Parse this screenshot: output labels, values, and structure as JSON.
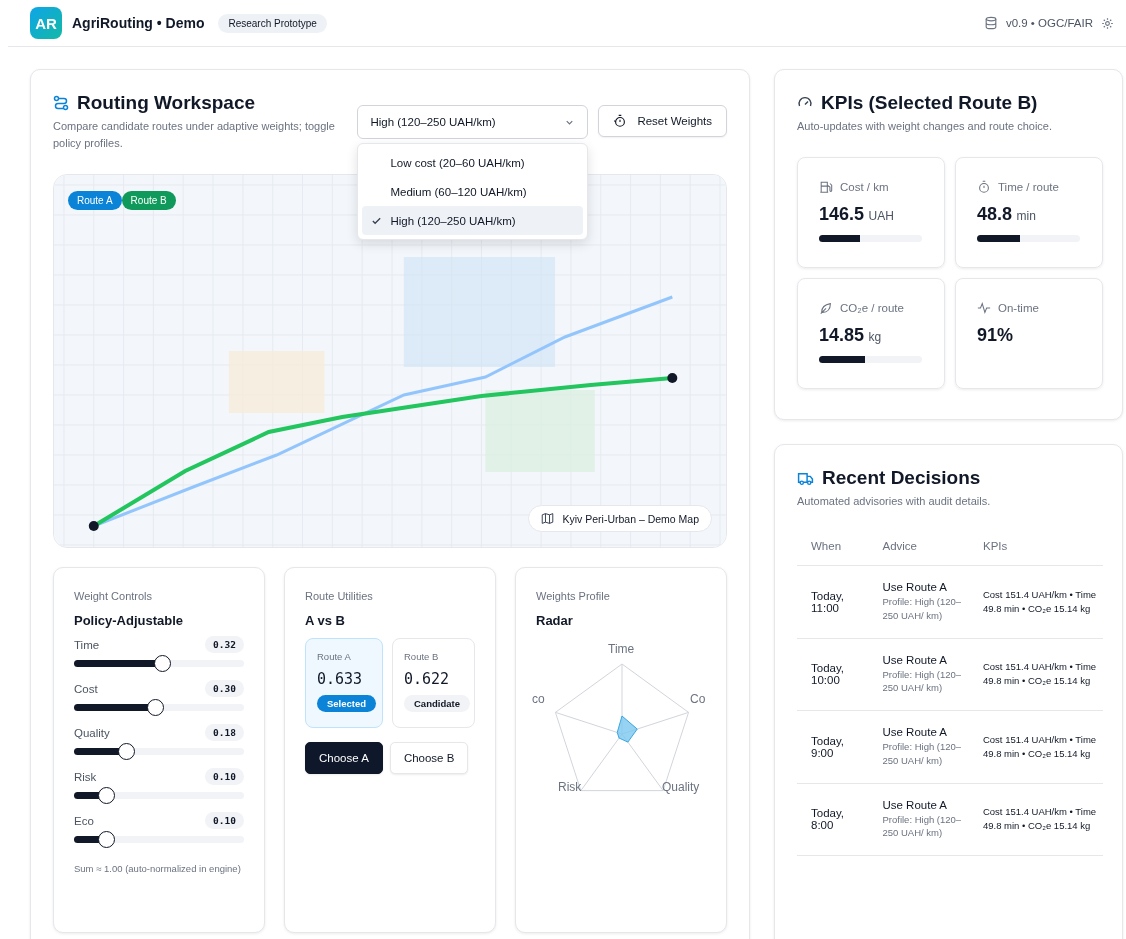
{
  "header": {
    "logo": "AR",
    "title": "AgriRouting • Demo",
    "badge": "Research Prototype",
    "version": "v0.9 • OGC/FAIR"
  },
  "workspace": {
    "title": "Routing Workspace",
    "subtitle": "Compare candidate routes under adaptive weights; toggle policy profiles.",
    "select": {
      "value": "High (120–250 UAH/km)",
      "options": [
        {
          "label": "Low cost (20–60 UAH/km)",
          "selected": false
        },
        {
          "label": "Medium (60–120 UAH/km)",
          "selected": false
        },
        {
          "label": "High (120–250 UAH/km)",
          "selected": true
        }
      ]
    },
    "reset_button": "Reset Weights",
    "map": {
      "legend": [
        {
          "label": "Route A",
          "color": "#0b84d8"
        },
        {
          "label": "Route B",
          "color": "#0f9a5c"
        }
      ],
      "caption": "Kyiv Peri-Urban – Demo Map"
    }
  },
  "weights": {
    "overline": "Weight Controls",
    "title": "Policy-Adjustable",
    "sliders": [
      {
        "name": "Time",
        "value": "0.32",
        "level": 0.53
      },
      {
        "name": "Cost",
        "value": "0.30",
        "level": 0.49
      },
      {
        "name": "Quality",
        "value": "0.18",
        "level": 0.32
      },
      {
        "name": "Risk",
        "value": "0.10",
        "level": 0.2
      },
      {
        "name": "Eco",
        "value": "0.10",
        "level": 0.2
      }
    ],
    "note": "Sum ≈ 1.00 (auto-normalized in engine)"
  },
  "utilities": {
    "overline": "Route Utilities",
    "title": "A vs B",
    "routes": [
      {
        "label": "Route A",
        "score": "0.633",
        "status": "Selected",
        "selected": true
      },
      {
        "label": "Route B",
        "score": "0.622",
        "status": "Candidate",
        "selected": false
      }
    ],
    "buttons": [
      {
        "label": "Choose A",
        "primary": true
      },
      {
        "label": "Choose B",
        "primary": false
      }
    ]
  },
  "profile": {
    "overline": "Weights Profile",
    "title": "Radar",
    "axes": [
      "Time",
      "Co",
      "Quality",
      "Risk",
      "co"
    ]
  },
  "kpis": {
    "title": "KPIs (Selected Route B)",
    "subtitle": "Auto-updates with weight changes and route choice.",
    "cards": [
      {
        "kind": "fuel",
        "label": "Cost / km",
        "value": "146.5",
        "unit": "UAH",
        "level": 0.4
      },
      {
        "kind": "timer",
        "label": "Time / route",
        "value": "48.8",
        "unit": "min",
        "level": 0.42
      },
      {
        "kind": "leaf",
        "label": "CO₂e / route",
        "value": "14.85",
        "unit": "kg",
        "level": 0.45
      },
      {
        "kind": "pulse",
        "label": "On-time",
        "value": "91%"
      }
    ]
  },
  "decisions": {
    "title": "Recent Decisions",
    "subtitle": "Automated advisories with audit details.",
    "columns": [
      "When",
      "Advice",
      "KPIs"
    ],
    "rows": [
      {
        "when": "Today, 11:00",
        "advice": "Use Route A",
        "profile": "Profile: High (120–250 UAH/ km)",
        "kpis": "Cost 151.4 UAH/km • Time 49.8 min • CO₂e 15.14 kg"
      },
      {
        "when": "Today, 10:00",
        "advice": "Use Route A",
        "profile": "Profile: High (120–250 UAH/ km)",
        "kpis": "Cost 151.4 UAH/km • Time 49.8 min • CO₂e 15.14 kg"
      },
      {
        "when": "Today, 9:00",
        "advice": "Use Route A",
        "profile": "Profile: High (120–250 UAH/ km)",
        "kpis": "Cost 151.4 UAH/km • Time 49.8 min • CO₂e 15.14 kg"
      },
      {
        "when": "Today, 8:00",
        "advice": "Use Route A",
        "profile": "Profile: High (120–250 UAH/ km)",
        "kpis": "Cost 151.4 UAH/km • Time 49.8 min • CO₂e 15.14 kg"
      }
    ]
  }
}
